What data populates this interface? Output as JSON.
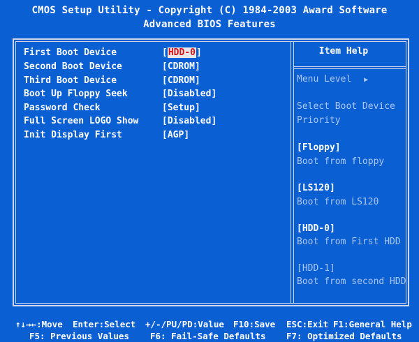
{
  "header": {
    "line1": "CMOS Setup Utility - Copyright (C) 1984-2003 Award Software",
    "line2": "Advanced BIOS Features"
  },
  "settings": [
    {
      "label": "First Boot Device",
      "value": "HDD-0",
      "selected": true
    },
    {
      "label": "Second Boot Device",
      "value": "CDROM",
      "selected": false
    },
    {
      "label": "Third Boot Device",
      "value": "CDROM",
      "selected": false
    },
    {
      "label": "Boot Up Floppy Seek",
      "value": "Disabled",
      "selected": false
    },
    {
      "label": "Password Check",
      "value": "Setup",
      "selected": false
    },
    {
      "label": "Full Screen LOGO Show",
      "value": "Disabled",
      "selected": false
    },
    {
      "label": "Init Display First",
      "value": "AGP",
      "selected": false
    }
  ],
  "help": {
    "title": "Item Help",
    "menu_level": "Menu Level",
    "menu_level_arrow": "▶",
    "description_1": "Select Boot Device",
    "description_2": "Priority",
    "options": [
      {
        "name": "[Floppy]",
        "desc": "Boot from floppy"
      },
      {
        "name": "[LS120]",
        "desc": "Boot from LS120"
      },
      {
        "name": "[HDD-0]",
        "desc": "Boot from First HDD"
      },
      {
        "name": "[HDD-1]",
        "desc": "Boot from second HDD"
      }
    ]
  },
  "footer": {
    "move": "↑↓→←:Move",
    "select": "Enter:Select",
    "value": "+/-/PU/PD:Value",
    "save": "F10:Save",
    "exit": "ESC:Exit",
    "help": "F1:General Help",
    "previous": "F5: Previous Values",
    "failsafe": "F6: Fail-Safe Defaults",
    "optimized": "F7: Optimized Defaults"
  },
  "colors": {
    "background": "#0a5fd3",
    "text": "#ffffff",
    "dim_text": "#a9c6f5",
    "highlight_bg": "#e8e8e8",
    "highlight_text": "#d8141a"
  }
}
